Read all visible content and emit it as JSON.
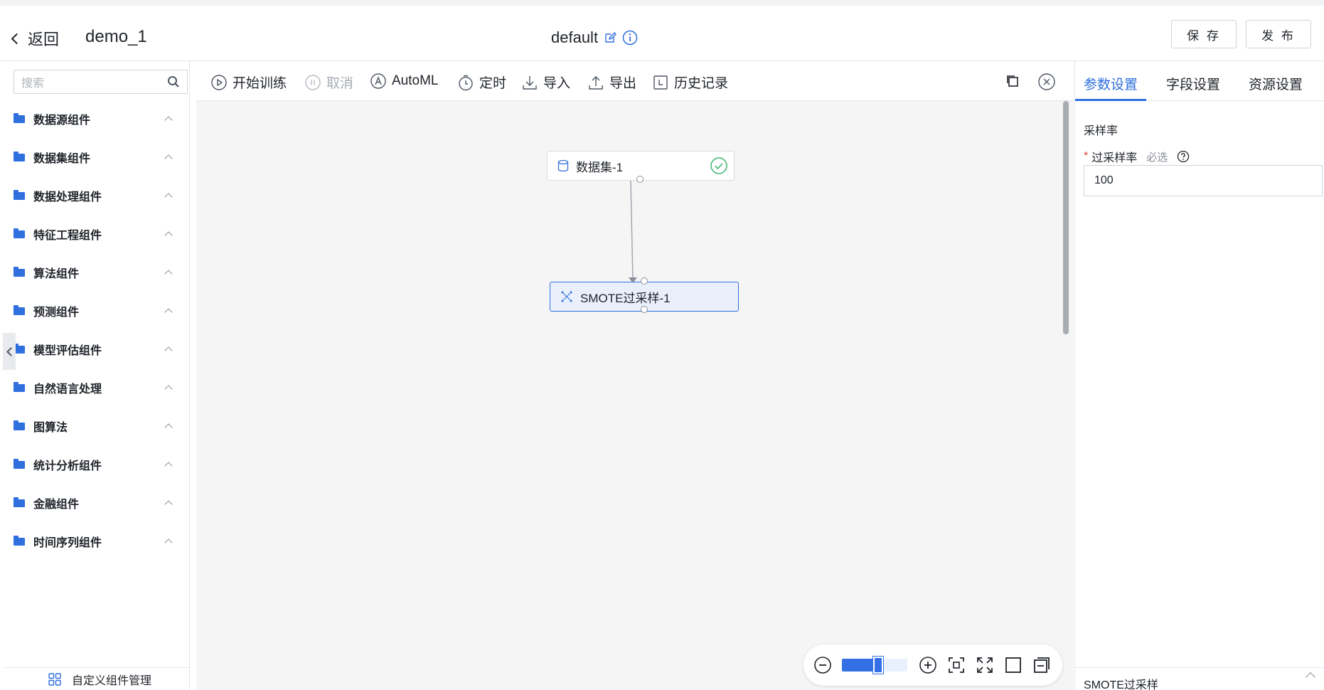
{
  "header": {
    "back_label": "返回",
    "project_name": "demo_1",
    "workspace": "default",
    "save_label": "保 存",
    "publish_label": "发 布"
  },
  "sidebar": {
    "search_placeholder": "搜索",
    "items": [
      {
        "label": "数据源组件"
      },
      {
        "label": "数据集组件"
      },
      {
        "label": "数据处理组件"
      },
      {
        "label": "特征工程组件"
      },
      {
        "label": "算法组件"
      },
      {
        "label": "预测组件"
      },
      {
        "label": "模型评估组件"
      },
      {
        "label": "自然语言处理"
      },
      {
        "label": "图算法"
      },
      {
        "label": "统计分析组件"
      },
      {
        "label": "金融组件"
      },
      {
        "label": "时间序列组件"
      }
    ],
    "custom_manager_label": "自定义组件管理"
  },
  "toolbar": {
    "start_training": "开始训练",
    "cancel": "取消",
    "automl": "AutoML",
    "schedule": "定时",
    "import": "导入",
    "export": "导出",
    "history": "历史记录"
  },
  "canvas": {
    "nodes": [
      {
        "label": "数据集-1",
        "status": "success"
      },
      {
        "label": "SMOTE过采样-1",
        "status": "selected"
      }
    ],
    "zoom_level": 0.55
  },
  "right_panel": {
    "tabs": [
      "参数设置",
      "字段设置",
      "资源设置"
    ],
    "active_tab": 0,
    "section_title": "采样率",
    "field_label": "过采样率",
    "field_optional": "必选",
    "field_value": "100",
    "footer_title": "SMOTE过采样"
  },
  "colors": {
    "accent": "#2f6fde",
    "success": "#3bb56b",
    "required": "#e5463b"
  }
}
